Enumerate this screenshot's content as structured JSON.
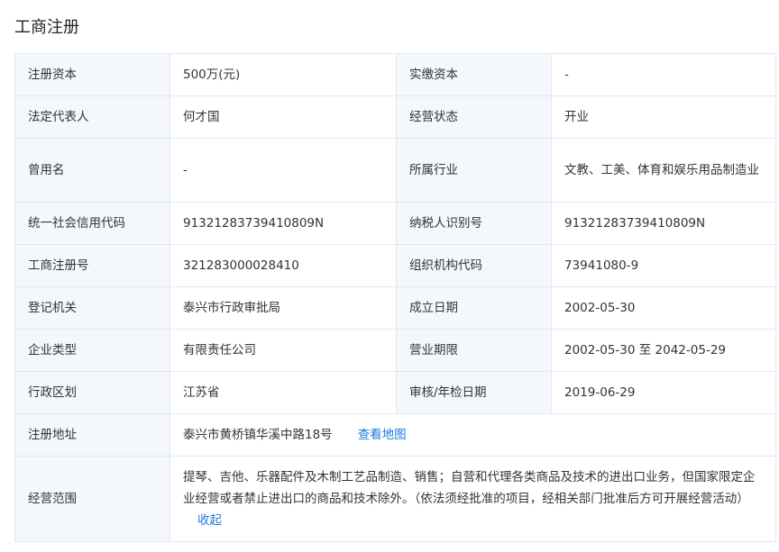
{
  "section_title": "工商注册",
  "colors": {
    "label_bg": "#f4f8fc",
    "border": "#e4e8ef",
    "link": "#1a7bd8"
  },
  "rows": [
    {
      "l1": "注册资本",
      "v1": "500万(元)",
      "l2": "实缴资本",
      "v2": "-"
    },
    {
      "l1": "法定代表人",
      "v1": "何才国",
      "l2": "经营状态",
      "v2": "开业"
    },
    {
      "l1": "曾用名",
      "v1": "-",
      "l2": "所属行业",
      "v2": "文教、工美、体育和娱乐用品制造业"
    },
    {
      "l1": "统一社会信用代码",
      "v1": "91321283739410809N",
      "l2": "纳税人识别号",
      "v2": "91321283739410809N"
    },
    {
      "l1": "工商注册号",
      "v1": "321283000028410",
      "l2": "组织机构代码",
      "v2": "73941080-9"
    },
    {
      "l1": "登记机关",
      "v1": "泰兴市行政审批局",
      "l2": "成立日期",
      "v2": "2002-05-30"
    },
    {
      "l1": "企业类型",
      "v1": "有限责任公司",
      "l2": "营业期限",
      "v2": "2002-05-30 至 2042-05-29"
    },
    {
      "l1": "行政区划",
      "v1": "江苏省",
      "l2": "审核/年检日期",
      "v2": "2019-06-29"
    }
  ],
  "address": {
    "label": "注册地址",
    "value": "泰兴市黄桥镇华溪中路18号",
    "map_link": "查看地图"
  },
  "scope": {
    "label": "经营范围",
    "value": "提琴、吉他、乐器配件及木制工艺品制造、销售；自营和代理各类商品及技术的进出口业务，但国家限定企业经营或者禁止进出口的商品和技术除外。（依法须经批准的项目，经相关部门批准后方可开展经营活动）",
    "collapse_link": "收起"
  }
}
